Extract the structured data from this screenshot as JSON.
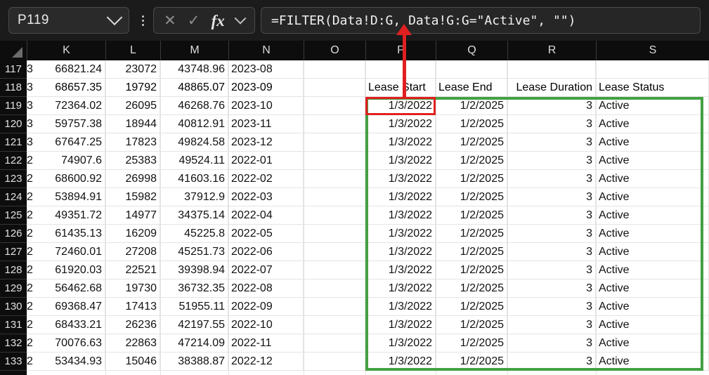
{
  "app": {
    "name_box_value": "P119",
    "formula": "=FILTER(Data!D:G, Data!G:G=\"Active\", \"\")",
    "cancel_icon": "✕",
    "confirm_icon": "✓",
    "fx_icon": "fx",
    "accent_selection_color": "#e02020",
    "accent_highlight_color": "#44a043"
  },
  "grid": {
    "column_headers": [
      "K",
      "L",
      "M",
      "N",
      "O",
      "P",
      "Q",
      "R",
      "S"
    ],
    "row_numbers": [
      117,
      118,
      119,
      120,
      121,
      122,
      123,
      124,
      125,
      126,
      127,
      128,
      129,
      130,
      131,
      132,
      133
    ],
    "spill_headers": {
      "lease_start": "Lease Start",
      "lease_end": "Lease End",
      "lease_duration": "Lease Duration",
      "lease_status": "Lease Status"
    },
    "rows": [
      {
        "rownum": "117",
        "j": "3",
        "k": "66821.24",
        "l": "23072",
        "m": "43748.96",
        "n": "2023-08",
        "o": "",
        "p": "",
        "q": "",
        "r": "",
        "s": ""
      },
      {
        "rownum": "118",
        "j": "3",
        "k": "68657.35",
        "l": "19792",
        "m": "48865.07",
        "n": "2023-09",
        "o": "",
        "p": "Lease Start",
        "q": "Lease End",
        "r": "Lease Duration",
        "s": "Lease Status"
      },
      {
        "rownum": "119",
        "j": "3",
        "k": "72364.02",
        "l": "26095",
        "m": "46268.76",
        "n": "2023-10",
        "o": "",
        "p": "1/3/2022",
        "q": "1/2/2025",
        "r": "3",
        "s": "Active"
      },
      {
        "rownum": "120",
        "j": "3",
        "k": "59757.38",
        "l": "18944",
        "m": "40812.91",
        "n": "2023-11",
        "o": "",
        "p": "1/3/2022",
        "q": "1/2/2025",
        "r": "3",
        "s": "Active"
      },
      {
        "rownum": "121",
        "j": "3",
        "k": "67647.25",
        "l": "17823",
        "m": "49824.58",
        "n": "2023-12",
        "o": "",
        "p": "1/3/2022",
        "q": "1/2/2025",
        "r": "3",
        "s": "Active"
      },
      {
        "rownum": "122",
        "j": "2",
        "k": "74907.6",
        "l": "25383",
        "m": "49524.11",
        "n": "2022-01",
        "o": "",
        "p": "1/3/2022",
        "q": "1/2/2025",
        "r": "3",
        "s": "Active"
      },
      {
        "rownum": "123",
        "j": "2",
        "k": "68600.92",
        "l": "26998",
        "m": "41603.16",
        "n": "2022-02",
        "o": "",
        "p": "1/3/2022",
        "q": "1/2/2025",
        "r": "3",
        "s": "Active"
      },
      {
        "rownum": "124",
        "j": "2",
        "k": "53894.91",
        "l": "15982",
        "m": "37912.9",
        "n": "2022-03",
        "o": "",
        "p": "1/3/2022",
        "q": "1/2/2025",
        "r": "3",
        "s": "Active"
      },
      {
        "rownum": "125",
        "j": "2",
        "k": "49351.72",
        "l": "14977",
        "m": "34375.14",
        "n": "2022-04",
        "o": "",
        "p": "1/3/2022",
        "q": "1/2/2025",
        "r": "3",
        "s": "Active"
      },
      {
        "rownum": "126",
        "j": "2",
        "k": "61435.13",
        "l": "16209",
        "m": "45225.8",
        "n": "2022-05",
        "o": "",
        "p": "1/3/2022",
        "q": "1/2/2025",
        "r": "3",
        "s": "Active"
      },
      {
        "rownum": "127",
        "j": "2",
        "k": "72460.01",
        "l": "27208",
        "m": "45251.73",
        "n": "2022-06",
        "o": "",
        "p": "1/3/2022",
        "q": "1/2/2025",
        "r": "3",
        "s": "Active"
      },
      {
        "rownum": "128",
        "j": "2",
        "k": "61920.03",
        "l": "22521",
        "m": "39398.94",
        "n": "2022-07",
        "o": "",
        "p": "1/3/2022",
        "q": "1/2/2025",
        "r": "3",
        "s": "Active"
      },
      {
        "rownum": "129",
        "j": "2",
        "k": "56462.68",
        "l": "19730",
        "m": "36732.35",
        "n": "2022-08",
        "o": "",
        "p": "1/3/2022",
        "q": "1/2/2025",
        "r": "3",
        "s": "Active"
      },
      {
        "rownum": "130",
        "j": "2",
        "k": "69368.47",
        "l": "17413",
        "m": "51955.11",
        "n": "2022-09",
        "o": "",
        "p": "1/3/2022",
        "q": "1/2/2025",
        "r": "3",
        "s": "Active"
      },
      {
        "rownum": "131",
        "j": "2",
        "k": "68433.21",
        "l": "26236",
        "m": "42197.55",
        "n": "2022-10",
        "o": "",
        "p": "1/3/2022",
        "q": "1/2/2025",
        "r": "3",
        "s": "Active"
      },
      {
        "rownum": "132",
        "j": "2",
        "k": "70076.63",
        "l": "22863",
        "m": "47214.09",
        "n": "2022-11",
        "o": "",
        "p": "1/3/2022",
        "q": "1/2/2025",
        "r": "3",
        "s": "Active"
      },
      {
        "rownum": "133",
        "j": "2",
        "k": "53434.93",
        "l": "15046",
        "m": "38388.87",
        "n": "2022-12",
        "o": "",
        "p": "1/3/2022",
        "q": "1/2/2025",
        "r": "3",
        "s": "Active"
      }
    ]
  }
}
